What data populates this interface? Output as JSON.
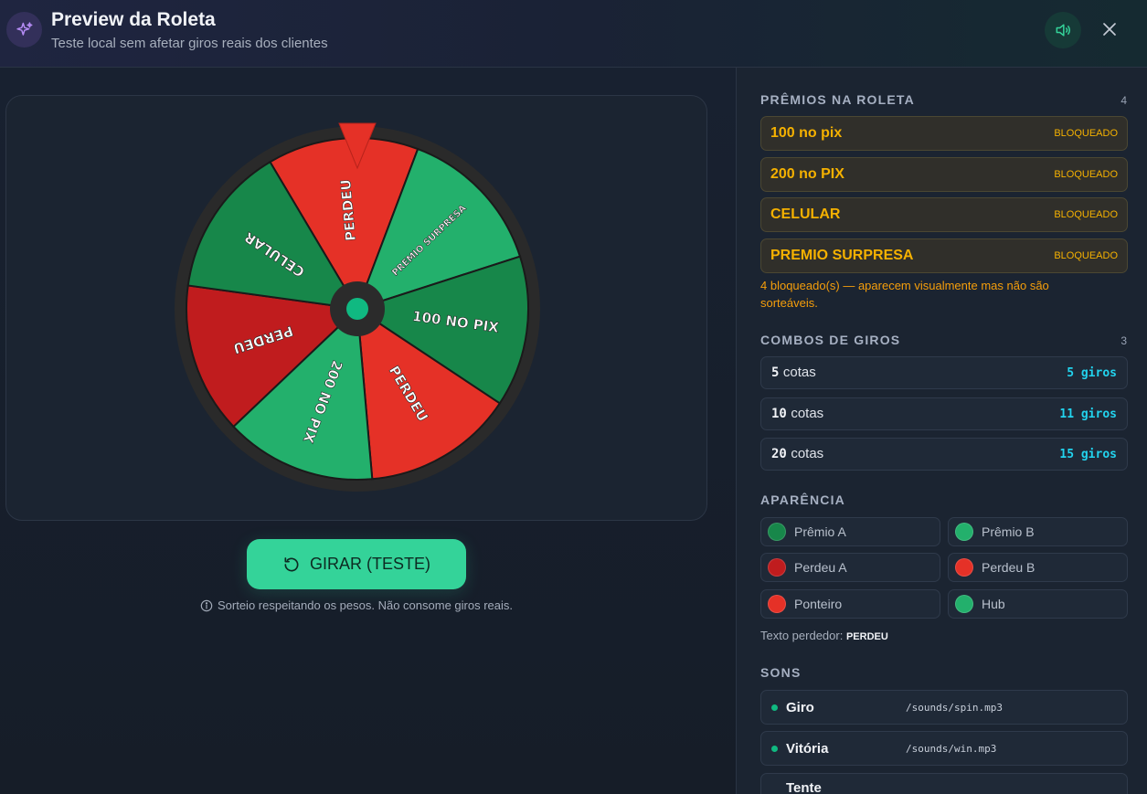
{
  "header": {
    "title": "Preview da Roleta",
    "subtitle": "Teste local sem afetar giros reais dos clientes"
  },
  "wheel": {
    "segments": [
      {
        "label": "PERDEU",
        "color": "#e53127"
      },
      {
        "label": "PREMIO SURPRESA",
        "color": "#23b06c"
      },
      {
        "label": "100 NO PIX",
        "color": "#17874a"
      },
      {
        "label": "PERDEU",
        "color": "#e53127"
      },
      {
        "label": "200 NO PIX",
        "color": "#23b06c"
      },
      {
        "label": "PERDEU",
        "color": "#c01c1e"
      },
      {
        "label": "CELULAR",
        "color": "#17874a"
      }
    ],
    "pointer_color": "#e53127",
    "hub_color": "#10b981"
  },
  "spin_button": {
    "label": "GIRAR (TESTE)"
  },
  "spin_note": "Sorteio respeitando os pesos. Não consome giros reais.",
  "prizes": {
    "title": "PRÊMIOS NA ROLETA",
    "count": "4",
    "items": [
      {
        "name": "100 no pix",
        "status": "BLOQUEADO"
      },
      {
        "name": "200 no PIX",
        "status": "BLOQUEADO"
      },
      {
        "name": "CELULAR",
        "status": "BLOQUEADO"
      },
      {
        "name": "PREMIO SURPRESA",
        "status": "BLOQUEADO"
      }
    ],
    "blocked_note": "4 bloqueado(s) — aparecem visualmente mas não são sorteáveis."
  },
  "combos": {
    "title": "COMBOS DE GIROS",
    "count": "3",
    "items": [
      {
        "qty": "5",
        "unit": "cotas",
        "giros": "5 giros"
      },
      {
        "qty": "10",
        "unit": "cotas",
        "giros": "11 giros"
      },
      {
        "qty": "20",
        "unit": "cotas",
        "giros": "15 giros"
      }
    ]
  },
  "appearance": {
    "title": "APARÊNCIA",
    "swatches": [
      {
        "label": "Prêmio A",
        "color": "#17874a"
      },
      {
        "label": "Prêmio B",
        "color": "#23b06c"
      },
      {
        "label": "Perdeu A",
        "color": "#c01c1e"
      },
      {
        "label": "Perdeu B",
        "color": "#e53127"
      },
      {
        "label": "Ponteiro",
        "color": "#e53127"
      },
      {
        "label": "Hub",
        "color": "#23b06c"
      }
    ],
    "loser_text_label": "Texto perdedor:",
    "loser_text_value": "PERDEU"
  },
  "sounds": {
    "title": "SONS",
    "items": [
      {
        "name": "Giro",
        "path": "/sounds/spin.mp3"
      },
      {
        "name": "Vitória",
        "path": "/sounds/win.mp3"
      },
      {
        "name": "Tente",
        "path": ""
      }
    ]
  }
}
